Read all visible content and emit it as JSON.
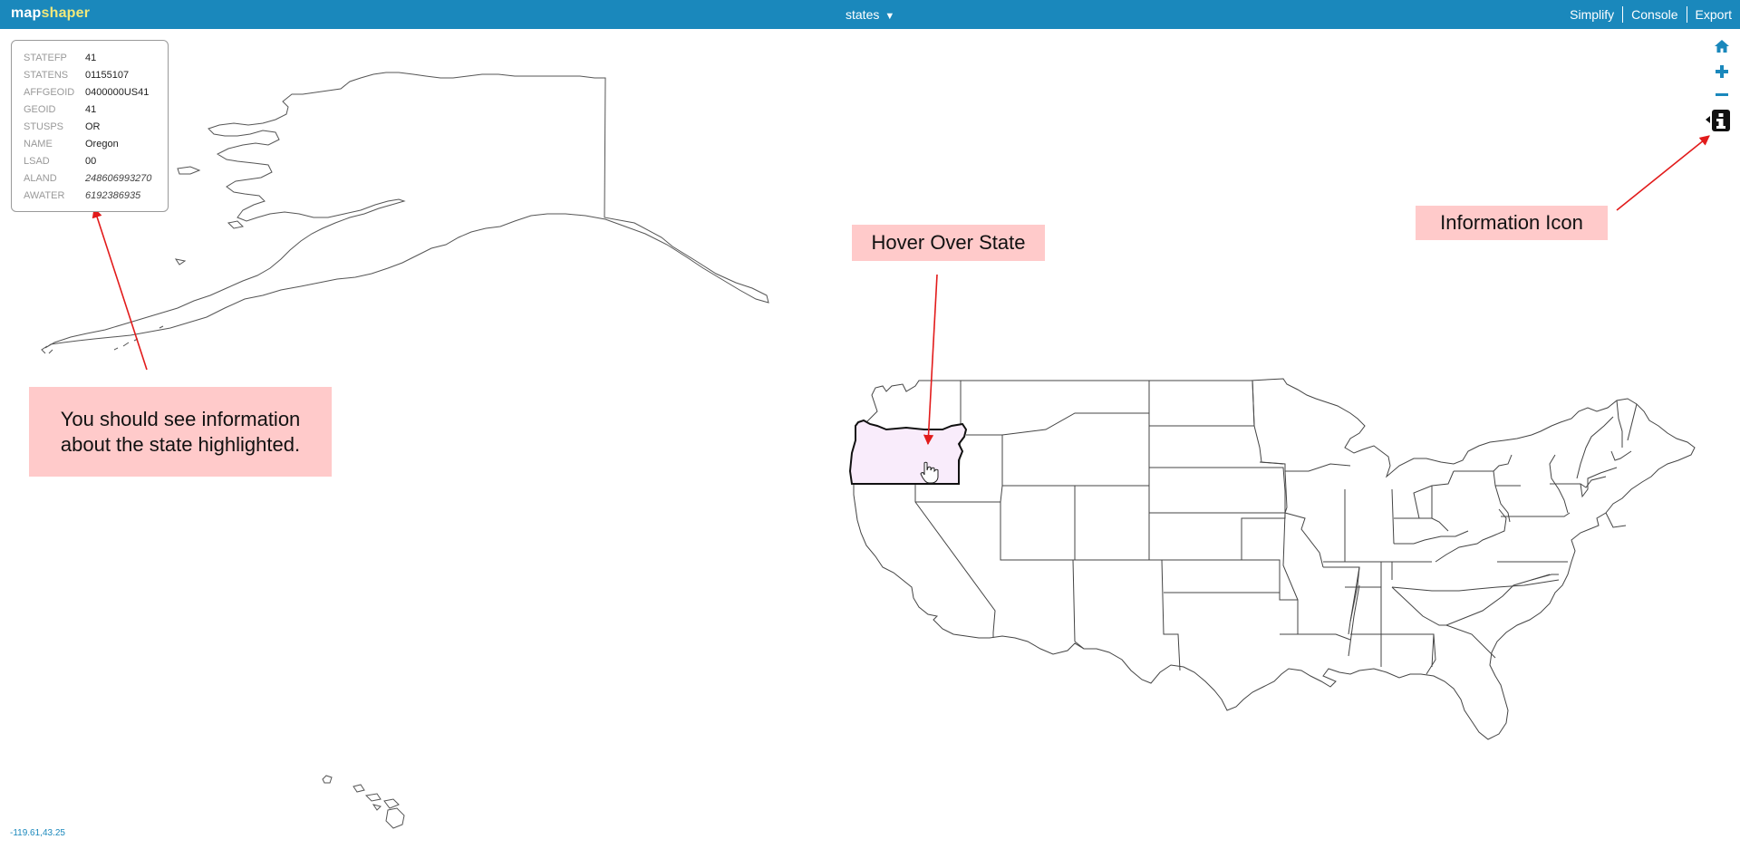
{
  "app": {
    "logo_part1": "map",
    "logo_part2": "shaper",
    "layer_name": "states",
    "layer_caret": "▼",
    "nav": [
      "Simplify",
      "Console",
      "Export"
    ]
  },
  "colors": {
    "topbar": "#1a88bc",
    "highlight_fill": "#f9ecfb",
    "callout_bg": "#ffcaca",
    "arrow": "#e21b1b"
  },
  "popup": {
    "rows": [
      {
        "key": "STATEFP",
        "value": "41"
      },
      {
        "key": "STATENS",
        "value": "01155107"
      },
      {
        "key": "AFFGEOID",
        "value": "0400000US41"
      },
      {
        "key": "GEOID",
        "value": "41"
      },
      {
        "key": "STUSPS",
        "value": "OR"
      },
      {
        "key": "NAME",
        "value": "Oregon"
      },
      {
        "key": "LSAD",
        "value": "00"
      },
      {
        "key": "ALAND",
        "value": "248606993270"
      },
      {
        "key": "AWATER",
        "value": "6192386935"
      }
    ]
  },
  "tools": {
    "home_icon": "home-icon",
    "zoom_in_icon": "plus-icon",
    "zoom_out_icon": "minus-icon",
    "info_icon": "info-icon"
  },
  "annotations": {
    "info_text": "You should see information about the state highlighted.",
    "hover_text": "Hover Over State",
    "icon_text": "Information Icon"
  },
  "status": {
    "coordinates": "-119.61,43.25"
  }
}
